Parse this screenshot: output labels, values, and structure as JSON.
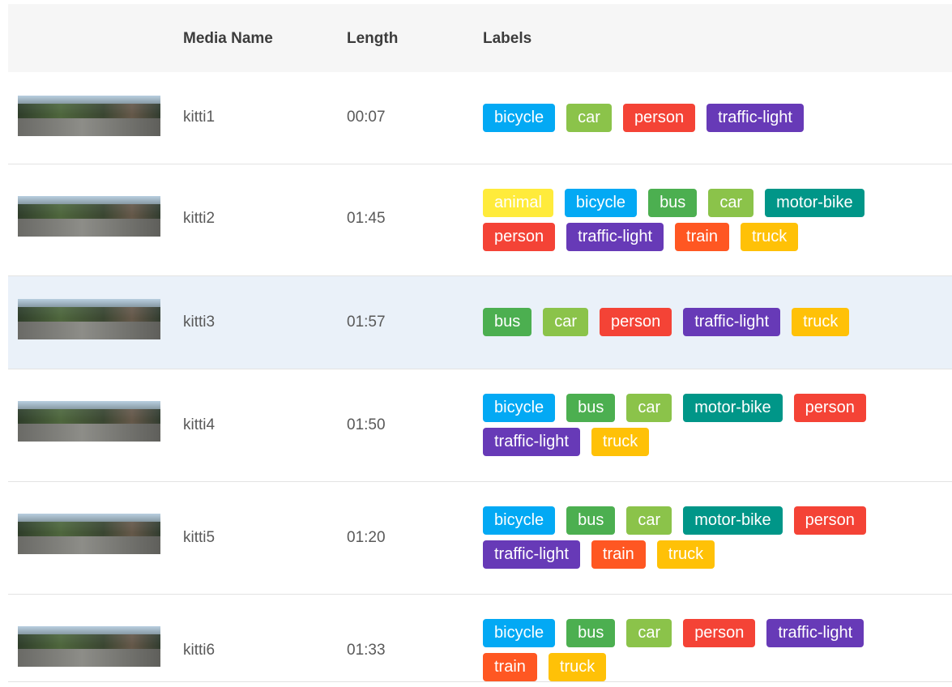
{
  "headers": {
    "media_name": "Media Name",
    "length": "Length",
    "labels": "Labels"
  },
  "label_colors": {
    "animal": "#ffeb3b",
    "bicycle": "#03a9f4",
    "bus": "#4caf50",
    "car": "#8bc34a",
    "motor-bike": "#009688",
    "person": "#f44336",
    "traffic-light": "#673ab7",
    "train": "#ff5722",
    "truck": "#ffc107"
  },
  "rows": [
    {
      "name": "kitti1",
      "length": "00:07",
      "selected": false,
      "labels": [
        "bicycle",
        "car",
        "person",
        "traffic-light"
      ]
    },
    {
      "name": "kitti2",
      "length": "01:45",
      "selected": false,
      "labels": [
        "animal",
        "bicycle",
        "bus",
        "car",
        "motor-bike",
        "person",
        "traffic-light",
        "train",
        "truck"
      ]
    },
    {
      "name": "kitti3",
      "length": "01:57",
      "selected": true,
      "labels": [
        "bus",
        "car",
        "person",
        "traffic-light",
        "truck"
      ]
    },
    {
      "name": "kitti4",
      "length": "01:50",
      "selected": false,
      "labels": [
        "bicycle",
        "bus",
        "car",
        "motor-bike",
        "person",
        "traffic-light",
        "truck"
      ]
    },
    {
      "name": "kitti5",
      "length": "01:20",
      "selected": false,
      "labels": [
        "bicycle",
        "bus",
        "car",
        "motor-bike",
        "person",
        "traffic-light",
        "train",
        "truck"
      ]
    },
    {
      "name": "kitti6",
      "length": "01:33",
      "selected": false,
      "labels": [
        "bicycle",
        "bus",
        "car",
        "person",
        "traffic-light",
        "train",
        "truck"
      ]
    }
  ]
}
